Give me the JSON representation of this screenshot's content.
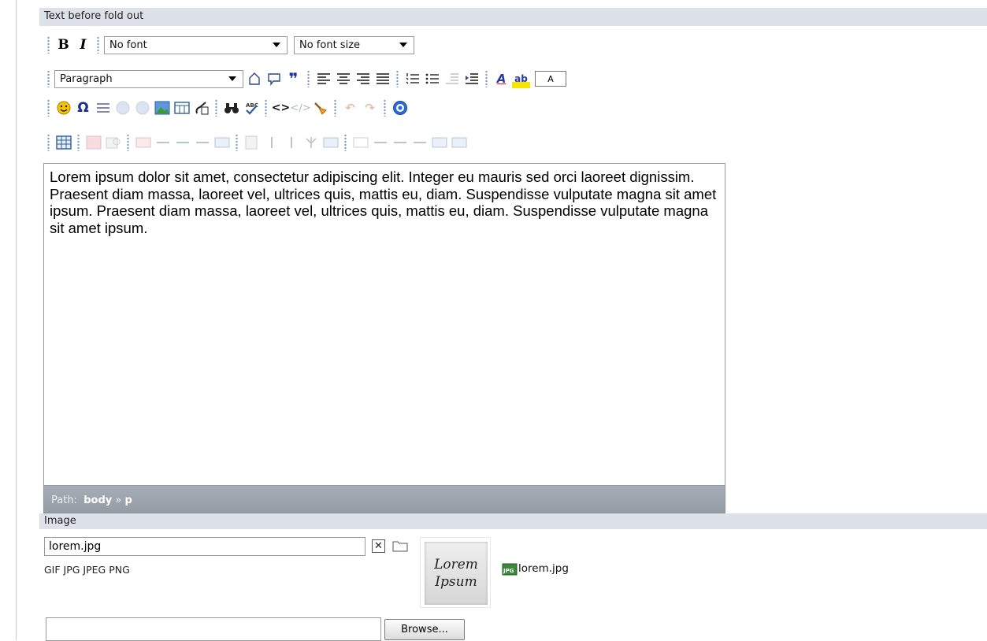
{
  "sections": {
    "text_label": "Text before fold out",
    "image_label": "Image"
  },
  "toolbar": {
    "bold": "B",
    "italic": "I",
    "font_family_value": "No font",
    "font_size_value": "No font size",
    "block_format_value": "Paragraph",
    "blockquote_glyph": "❞",
    "special_char_glyph": "Ω",
    "emoji_glyph": "☺",
    "find_glyph": "⚲",
    "code_glyph": "<>",
    "html_glyph": "<∕>",
    "help_glyph": "?",
    "forecolor_glyph": "A",
    "backcolor_glyph": "ab",
    "color_swatch": "A",
    "undo_glyph": "↶",
    "redo_glyph": "↷"
  },
  "editor": {
    "content": "Lorem ipsum dolor sit amet, consectetur adipiscing elit. Integer eu mauris sed orci laoreet dignissim. Praesent diam massa, laoreet vel, ultrices quis, mattis eu, diam. Suspendisse vulputate magna sit amet ipsum. Praesent diam massa, laoreet vel, ultrices quis, mattis eu, diam. Suspendisse vulputate magna sit amet ipsum.",
    "path_label": "Path:",
    "path_body": "body",
    "path_sep": "»",
    "path_p": "p"
  },
  "image": {
    "filename_value": "lorem.jpg",
    "clear_glyph": "✕",
    "file_types": "GIF JPG JPEG PNG",
    "thumb_line1": "Lorem",
    "thumb_line2": "Ipsum",
    "file_link": "lorem.jpg",
    "jpg_badge": "JPG"
  },
  "upload": {
    "browse_label": "Browse..."
  },
  "colors": {
    "section_header_bg": "#dde2ea",
    "path_bar_bg": "#9ea4ad",
    "icon_blue": "#1d2e5a"
  }
}
